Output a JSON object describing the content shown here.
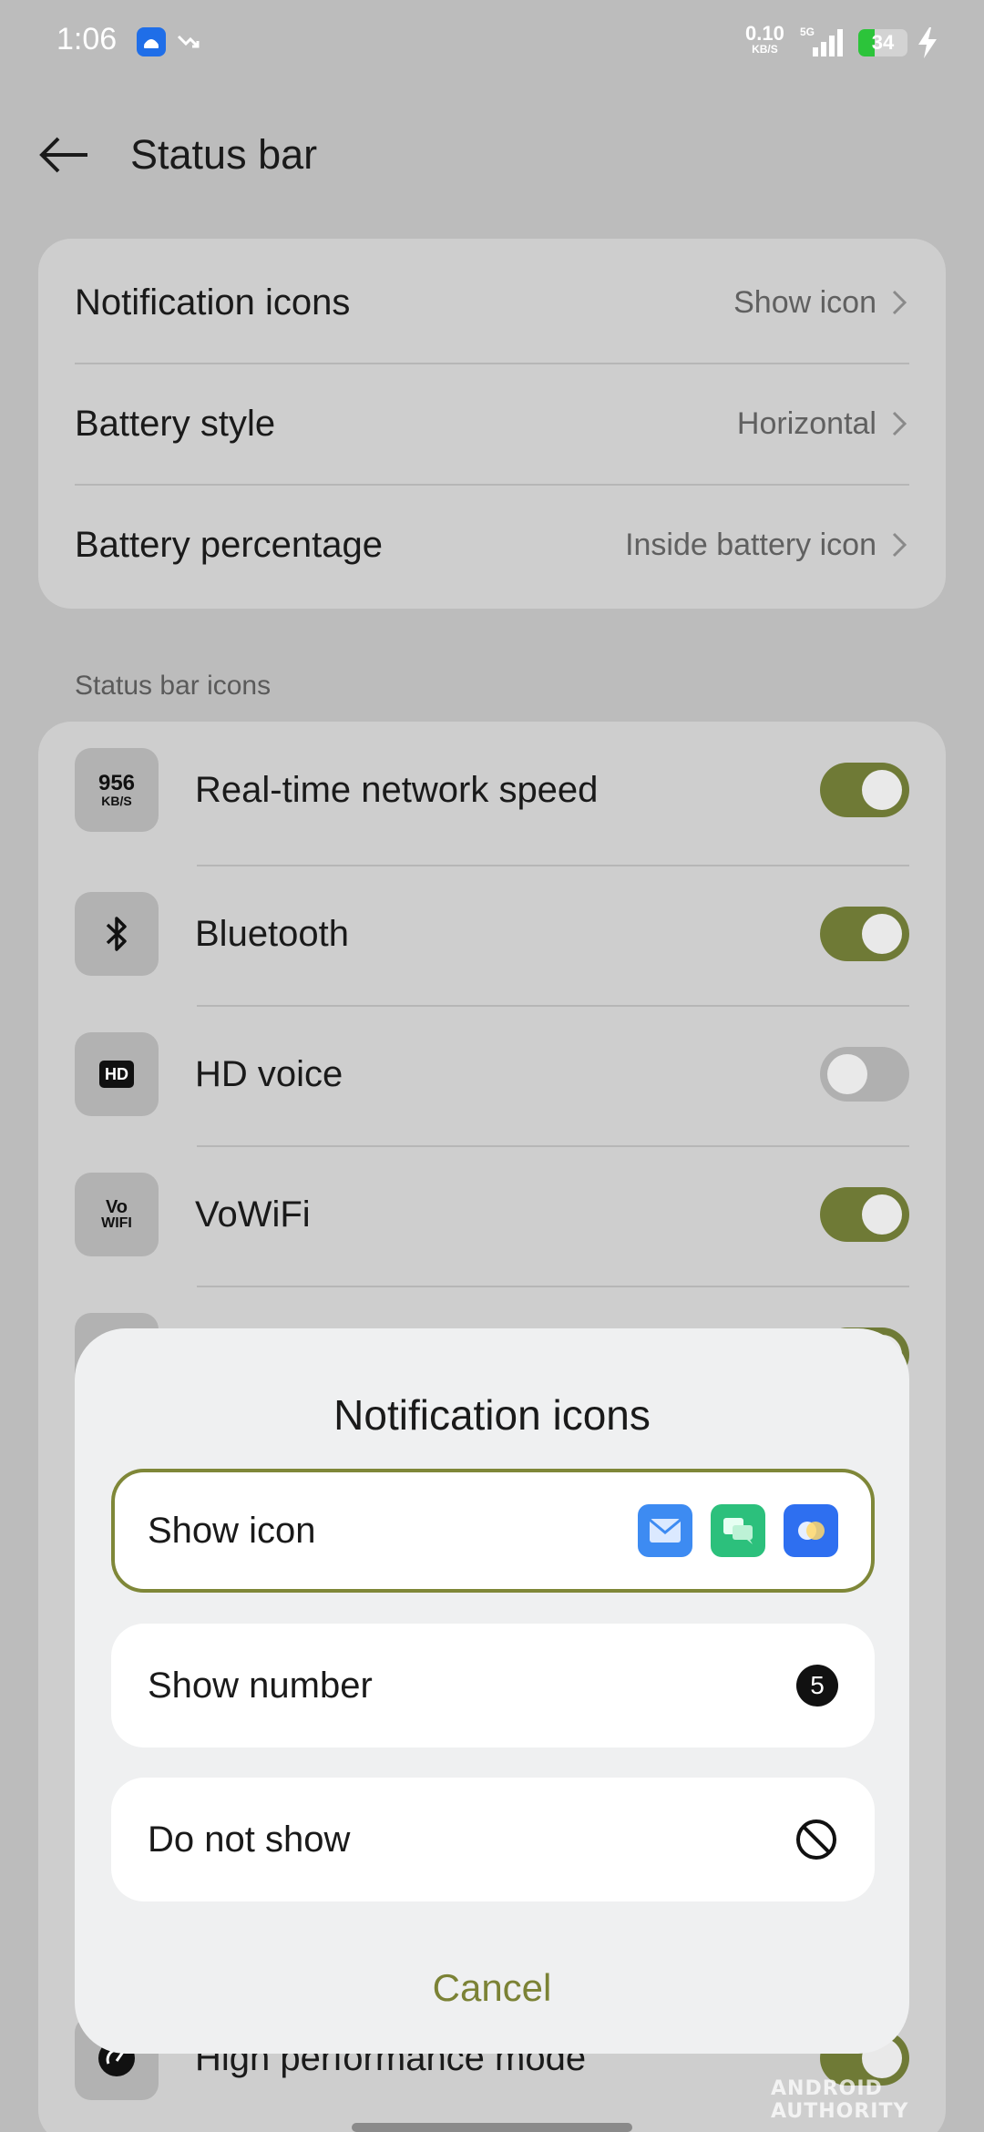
{
  "status_bar": {
    "time": "1:06",
    "net_speed_value": "0.10",
    "net_speed_unit": "KB/S",
    "network_type": "5G",
    "battery_level": "34",
    "battery_fraction": 0.34,
    "battery_color": "#2cc43a",
    "icons": [
      "app-notification-icon",
      "trend-arrow-icon",
      "signal-icon",
      "battery-icon",
      "charging-bolt-icon"
    ]
  },
  "header": {
    "title": "Status bar",
    "back_icon": "back-arrow-icon"
  },
  "settings_card": {
    "rows": [
      {
        "label": "Notification icons",
        "value": "Show icon"
      },
      {
        "label": "Battery style",
        "value": "Horizontal"
      },
      {
        "label": "Battery percentage",
        "value": "Inside battery icon"
      }
    ]
  },
  "status_bar_icons": {
    "section_label": "Status bar icons",
    "items": [
      {
        "label": "Real-time network speed",
        "tile_text_top": "956",
        "tile_text_bottom": "KB/S",
        "enabled": true
      },
      {
        "label": "Bluetooth",
        "icon": "bluetooth-icon",
        "enabled": true
      },
      {
        "label": "HD voice",
        "tile_text": "HD",
        "enabled": false
      },
      {
        "label": "VoWiFi",
        "tile_text_top": "Vo",
        "tile_text_bottom": "WIFI",
        "enabled": true
      },
      {
        "label": "High performance mode",
        "icon": "performance-icon",
        "enabled": true
      }
    ]
  },
  "dialog": {
    "title": "Notification icons",
    "options": [
      {
        "label": "Show icon",
        "selected": true,
        "icons": [
          "mail-app-icon",
          "messages-app-icon",
          "gallery-app-icon"
        ]
      },
      {
        "label": "Show number",
        "selected": false,
        "badge": "5"
      },
      {
        "label": "Do not show",
        "selected": false,
        "icon": "do-not-show-icon"
      }
    ],
    "cancel_label": "Cancel"
  },
  "watermark": "ANDROID AUTHORITY",
  "colors": {
    "accent": "#6f7a36",
    "accent_text": "#7b8235",
    "background_dim": "#bcbcbc",
    "card": "#cecece",
    "dialog": "#eff0f1"
  }
}
